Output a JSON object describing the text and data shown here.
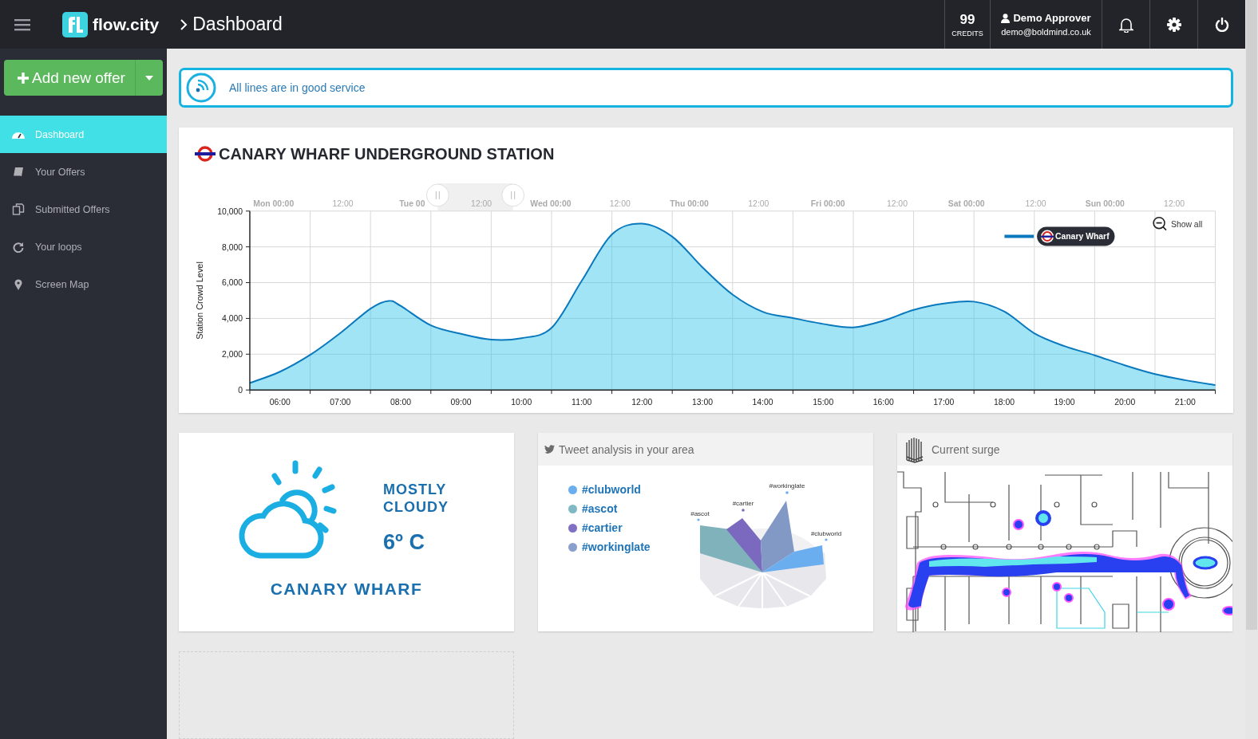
{
  "topbar": {
    "brand": "flow.city",
    "breadcrumb": "Dashboard",
    "credits": {
      "value": "99",
      "label": "CREDITS"
    },
    "user": {
      "name": "Demo Approver",
      "email": "demo@boldmind.co.uk"
    }
  },
  "sidebar": {
    "add_button": "Add new offer",
    "items": [
      {
        "label": "Dashboard",
        "selected": true
      },
      {
        "label": "Your Offers",
        "selected": false
      },
      {
        "label": "Submitted Offers",
        "selected": false
      },
      {
        "label": "Your loops",
        "selected": false
      },
      {
        "label": "Screen Map",
        "selected": false
      }
    ]
  },
  "alert": {
    "text": "All lines are in good service"
  },
  "station": {
    "title": "CANARY WHARF UNDERGROUND STATION",
    "navigator": [
      "Mon 00:00",
      "12:00",
      "Tue 00",
      "12:00",
      "Wed 00:00",
      "12:00",
      "Thu 00:00",
      "12:00",
      "Fri 00:00",
      "12:00",
      "Sat 00:00",
      "12:00",
      "Sun 00:00",
      "12:00"
    ],
    "show_all": "Show all",
    "chart_data": {
      "type": "area",
      "grid": true,
      "ylabel": "Station Crowd Level",
      "x": [
        5.5,
        6,
        6.5,
        7,
        7.5,
        7.8,
        8,
        8.5,
        9,
        9.5,
        10,
        10.5,
        11,
        11.5,
        12,
        12.5,
        13,
        13.5,
        14,
        14.5,
        15,
        15.5,
        16,
        16.5,
        17,
        17.5,
        18,
        18.5,
        19,
        19.5,
        20,
        20.5,
        21,
        21.5
      ],
      "series": [
        {
          "name": "Canary Wharf",
          "color": "#0a78bd",
          "values": [
            390,
            1020,
            1960,
            3180,
            4550,
            4980,
            4700,
            3610,
            3140,
            2820,
            2900,
            3470,
            6100,
            8700,
            9300,
            8570,
            6860,
            5330,
            4370,
            4020,
            3690,
            3500,
            3870,
            4480,
            4830,
            4940,
            4390,
            3170,
            2450,
            1940,
            1380,
            890,
            550,
            280
          ]
        }
      ],
      "xlim": [
        5.5,
        21.5
      ],
      "ylim": [
        0,
        10000
      ],
      "xticks": [
        {
          "value": 6,
          "label": "06:00"
        },
        {
          "value": 7,
          "label": "07:00"
        },
        {
          "value": 8,
          "label": "08:00"
        },
        {
          "value": 9,
          "label": "09:00"
        },
        {
          "value": 10,
          "label": "10:00"
        },
        {
          "value": 11,
          "label": "11:00"
        },
        {
          "value": 12,
          "label": "12:00"
        },
        {
          "value": 13,
          "label": "13:00"
        },
        {
          "value": 14,
          "label": "14:00"
        },
        {
          "value": 15,
          "label": "15:00"
        },
        {
          "value": 16,
          "label": "16:00"
        },
        {
          "value": 17,
          "label": "17:00"
        },
        {
          "value": 18,
          "label": "18:00"
        },
        {
          "value": 19,
          "label": "19:00"
        },
        {
          "value": 20,
          "label": "20:00"
        },
        {
          "value": 21,
          "label": "21:00"
        }
      ],
      "yticks": [
        {
          "value": 0,
          "label": "0"
        },
        {
          "value": 2000,
          "label": "2,000"
        },
        {
          "value": 4000,
          "label": "4,000"
        },
        {
          "value": 6000,
          "label": "6,000"
        },
        {
          "value": 8000,
          "label": "8,000"
        },
        {
          "value": 10000,
          "label": "10,000"
        }
      ]
    }
  },
  "weather": {
    "condition": "MOSTLY CLOUDY",
    "temperature": "6º C",
    "location": "CANARY WHARF"
  },
  "tweets": {
    "title": "Tweet analysis in your area",
    "hashtags": [
      {
        "label": "#clubworld",
        "color": "#6aaef0"
      },
      {
        "label": "#ascot",
        "color": "#80b9c4"
      },
      {
        "label": "#cartier",
        "color": "#8070c4"
      },
      {
        "label": "#workinglate",
        "color": "#8a9fcc"
      }
    ],
    "chart_labels": [
      "#workinglate",
      "#cartier",
      "#ascot",
      "#clubworld"
    ]
  },
  "surge": {
    "title": "Current surge"
  }
}
